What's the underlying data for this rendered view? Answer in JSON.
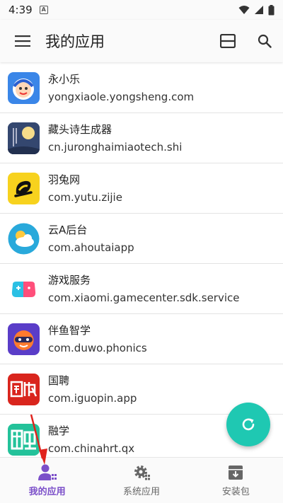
{
  "status_bar": {
    "time": "4:39",
    "badge": "A"
  },
  "header": {
    "title": "我的应用",
    "menu_icon": "hamburger-menu-icon",
    "view_icon": "view-toggle-icon",
    "search_icon": "search-icon"
  },
  "apps": [
    {
      "name": "永小乐",
      "package": "yongxiaole.yongsheng.com"
    },
    {
      "name": "藏头诗生成器",
      "package": "cn.juronghaimiaotech.shi"
    },
    {
      "name": "羽兔网",
      "package": "com.yutu.zijie"
    },
    {
      "name": "云A后台",
      "package": "com.ahoutaiapp"
    },
    {
      "name": "游戏服务",
      "package": "com.xiaomi.gamecenter.sdk.service"
    },
    {
      "name": "伴鱼智学",
      "package": "com.duwo.phonics"
    },
    {
      "name": "国聘",
      "package": "com.iguopin.app"
    },
    {
      "name": "融学",
      "package": "com.chinahrt.qx"
    }
  ],
  "bottom_nav": {
    "items": [
      {
        "label": "我的应用",
        "active": true
      },
      {
        "label": "系统应用",
        "active": false
      },
      {
        "label": "安装包",
        "active": false
      }
    ]
  },
  "colors": {
    "accent": "#7b4fc9",
    "fab": "#1fc8b2",
    "annotation": "#e0221c"
  }
}
